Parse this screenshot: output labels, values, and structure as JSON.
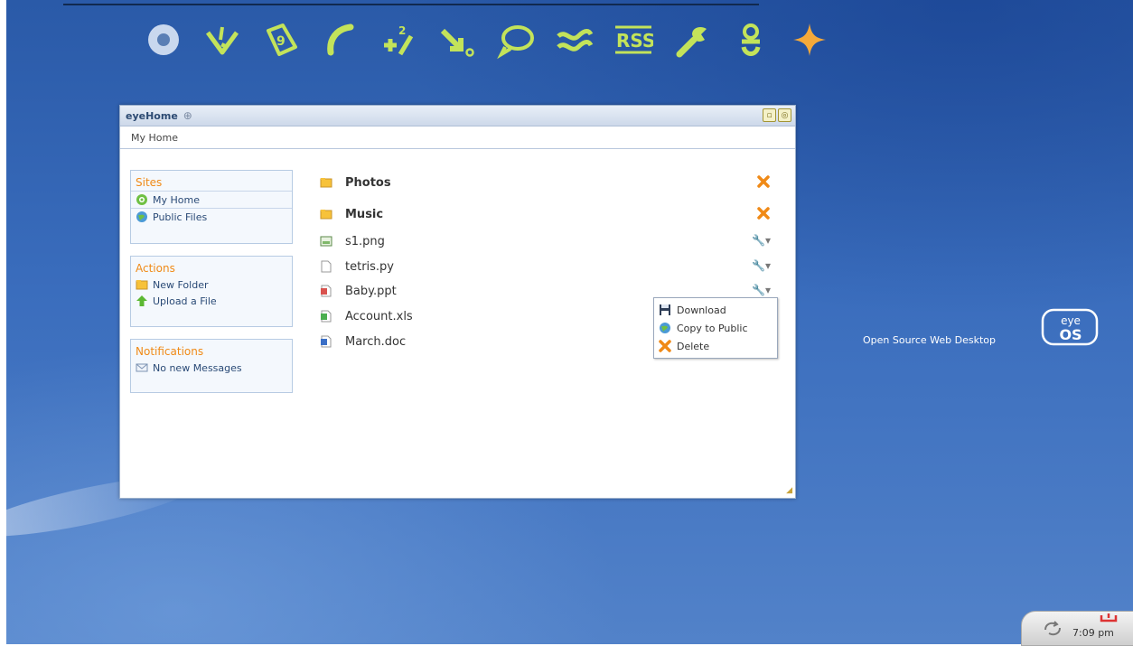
{
  "dock": [
    {
      "name": "eyeos-home-icon"
    },
    {
      "name": "tasks-icon"
    },
    {
      "name": "calendar-icon"
    },
    {
      "name": "phone-icon"
    },
    {
      "name": "calculator-icon"
    },
    {
      "name": "arrow-icon"
    },
    {
      "name": "chat-icon"
    },
    {
      "name": "waves-icon"
    },
    {
      "name": "rss-icon",
      "label": "RSS"
    },
    {
      "name": "wrench-icon"
    },
    {
      "name": "user-icon"
    },
    {
      "name": "plus-icon"
    }
  ],
  "window": {
    "title": "eyeHome",
    "breadcrumb": "My Home",
    "sidebar": {
      "sites": {
        "title": "Sites",
        "items": [
          "My Home",
          "Public Files"
        ]
      },
      "actions": {
        "title": "Actions",
        "items": [
          "New Folder",
          "Upload a File"
        ]
      },
      "notifications": {
        "title": "Notifications",
        "items": [
          "No new Messages"
        ]
      }
    },
    "files": [
      {
        "name": "Photos",
        "type": "folder"
      },
      {
        "name": "Music",
        "type": "folder"
      },
      {
        "name": "s1.png",
        "type": "image"
      },
      {
        "name": "tetris.py",
        "type": "text"
      },
      {
        "name": "Baby.ppt",
        "type": "presentation"
      },
      {
        "name": "Account.xls",
        "type": "spreadsheet"
      },
      {
        "name": "March.doc",
        "type": "document"
      }
    ],
    "context_menu": [
      "Download",
      "Copy to Public",
      "Delete"
    ]
  },
  "brand": {
    "tagline": "Open Source Web Desktop",
    "logo_top": "eye",
    "logo_bottom": "OS"
  },
  "tray": {
    "time": "7:09 pm"
  },
  "colors": {
    "accent_green": "#c3e35a",
    "orange": "#f08a17",
    "desktop_blue": "#3a6dbd"
  }
}
